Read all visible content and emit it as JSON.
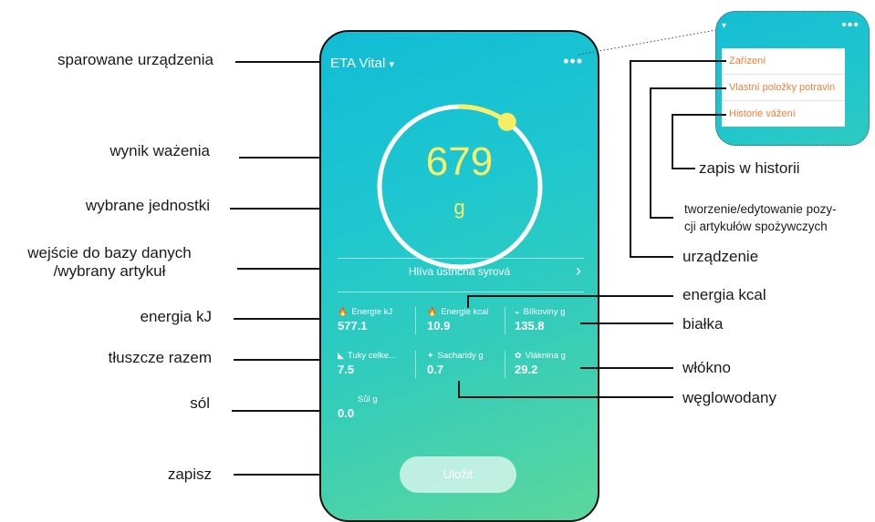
{
  "app": {
    "title": "ETA Vital",
    "caret": "▾",
    "menu_dots": "•••",
    "weight_value": "679",
    "weight_unit": "g",
    "food_item": "Hlíva ústřičná syrová",
    "food_arrow": "›",
    "save_label": "Uložit",
    "ring_progress": 0.1
  },
  "nutrients": [
    {
      "icon": "flame-icon",
      "glyph": "🔥",
      "name": "Energie kJ",
      "value": "577.1"
    },
    {
      "icon": "flame-icon",
      "glyph": "🔥",
      "name": "Energie kcal",
      "value": "10.9"
    },
    {
      "icon": "protein-icon",
      "glyph": "◒",
      "name": "Bílkoviny g",
      "value": "135.8"
    },
    {
      "icon": "fat-icon",
      "glyph": "◣",
      "name": "Tuky celke...",
      "value": "7.5"
    },
    {
      "icon": "carb-icon",
      "glyph": "✦",
      "name": "Sacharidy g",
      "value": "0.7"
    },
    {
      "icon": "fiber-icon",
      "glyph": "✿",
      "name": "Vláknina g",
      "value": "29.2"
    },
    {
      "icon": "salt-icon",
      "glyph": "",
      "name": "Sůl g",
      "value": "0.0"
    }
  ],
  "popup_menu": [
    "Zařízení",
    "Vlastní položky potravin",
    "Historie vážení"
  ],
  "labels_left": {
    "paired": "sparowane urządzenia",
    "weight": "wynik ważenia",
    "units": "wybrane jednostki",
    "db_line1": "wejście do bazy danych",
    "db_line2": "/wybrany artykuł",
    "energy_kj": "energia kJ",
    "fat": "tłuszcze razem",
    "salt": "sól",
    "save": "zapisz"
  },
  "labels_right": {
    "history": "zapis w historii",
    "custom_line1": "tworzenie/edytowanie pozy-",
    "custom_line2": "cji artykułów spożywczych",
    "device": "urządzenie",
    "energy_kcal": "energia kcal",
    "protein": "białka",
    "fiber": "włókno",
    "carb": "węglowodany"
  },
  "colors": {
    "accent_yellow": "#f7f06a",
    "menu_text": "#f07f39",
    "teal": "#1ec7cf",
    "green": "#5cd79c"
  }
}
